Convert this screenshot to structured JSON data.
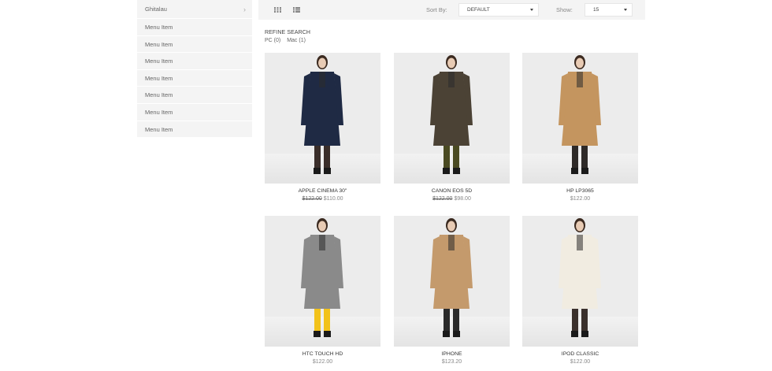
{
  "sidebar": {
    "items": [
      {
        "label": "Ghitalau"
      },
      {
        "label": "Menu Item"
      },
      {
        "label": "Menu Item"
      },
      {
        "label": "Menu Item"
      },
      {
        "label": "Menu Item"
      },
      {
        "label": "Menu Item"
      },
      {
        "label": "Menu Item"
      },
      {
        "label": "Menu Item"
      }
    ]
  },
  "toolbar": {
    "sort_label": "Sort By:",
    "sort_value": "DEFAULT",
    "show_label": "Show:",
    "show_value": "15",
    "grid_icon": "grid-view-icon",
    "list_icon": "list-view-icon"
  },
  "refine": {
    "title": "REFINE SEARCH",
    "links": [
      "PC (0)",
      "Mac (1)"
    ]
  },
  "products": [
    {
      "name": "APPLE CINEMA 30\"",
      "old_price": "$122.00",
      "price": "$110.00",
      "coat": "#1f2a44",
      "legs": "#3a2e2a"
    },
    {
      "name": "CANON EOS 5D",
      "old_price": "$122.00",
      "price": "$98.00",
      "coat": "#4b4235",
      "legs": "#4a4a22"
    },
    {
      "name": "HP LP3065",
      "old_price": "",
      "price": "$122.00",
      "coat": "#c4955f",
      "legs": "#2e2a28"
    },
    {
      "name": "HTC TOUCH HD",
      "old_price": "",
      "price": "$122.00",
      "coat": "#8a8a8a",
      "legs": "#f2c21a"
    },
    {
      "name": "IPHONE",
      "old_price": "",
      "price": "$123.20",
      "coat": "#c49a6c",
      "legs": "#2a2a2a"
    },
    {
      "name": "IPOD CLASSIC",
      "old_price": "",
      "price": "$122.00",
      "coat": "#f1ece1",
      "legs": "#3a302c"
    }
  ]
}
